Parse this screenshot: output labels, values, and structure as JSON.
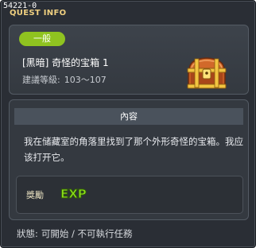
{
  "window": {
    "quest_id": "54221-0",
    "title": "QUEST INFO"
  },
  "summary": {
    "category_badge": "一般",
    "quest_name": "[黑暗] 奇怪的宝箱 1",
    "level_label": "建議等級:",
    "level_range": "103～107",
    "icon": "treasure-chest-icon"
  },
  "content": {
    "header": "內容",
    "description": "我在储藏室的角落里找到了那个外形奇怪的宝箱。我应该打开它。",
    "reward_label": "獎勵",
    "reward_icon": "exp-icon",
    "reward_icon_text": "EXP"
  },
  "status": {
    "label": "狀態:",
    "value": "可開始 / 不可執行任務"
  },
  "colors": {
    "badge_green": "#8fc320",
    "title_gold": "#f0d080",
    "exp_green": "#8fe21a"
  }
}
